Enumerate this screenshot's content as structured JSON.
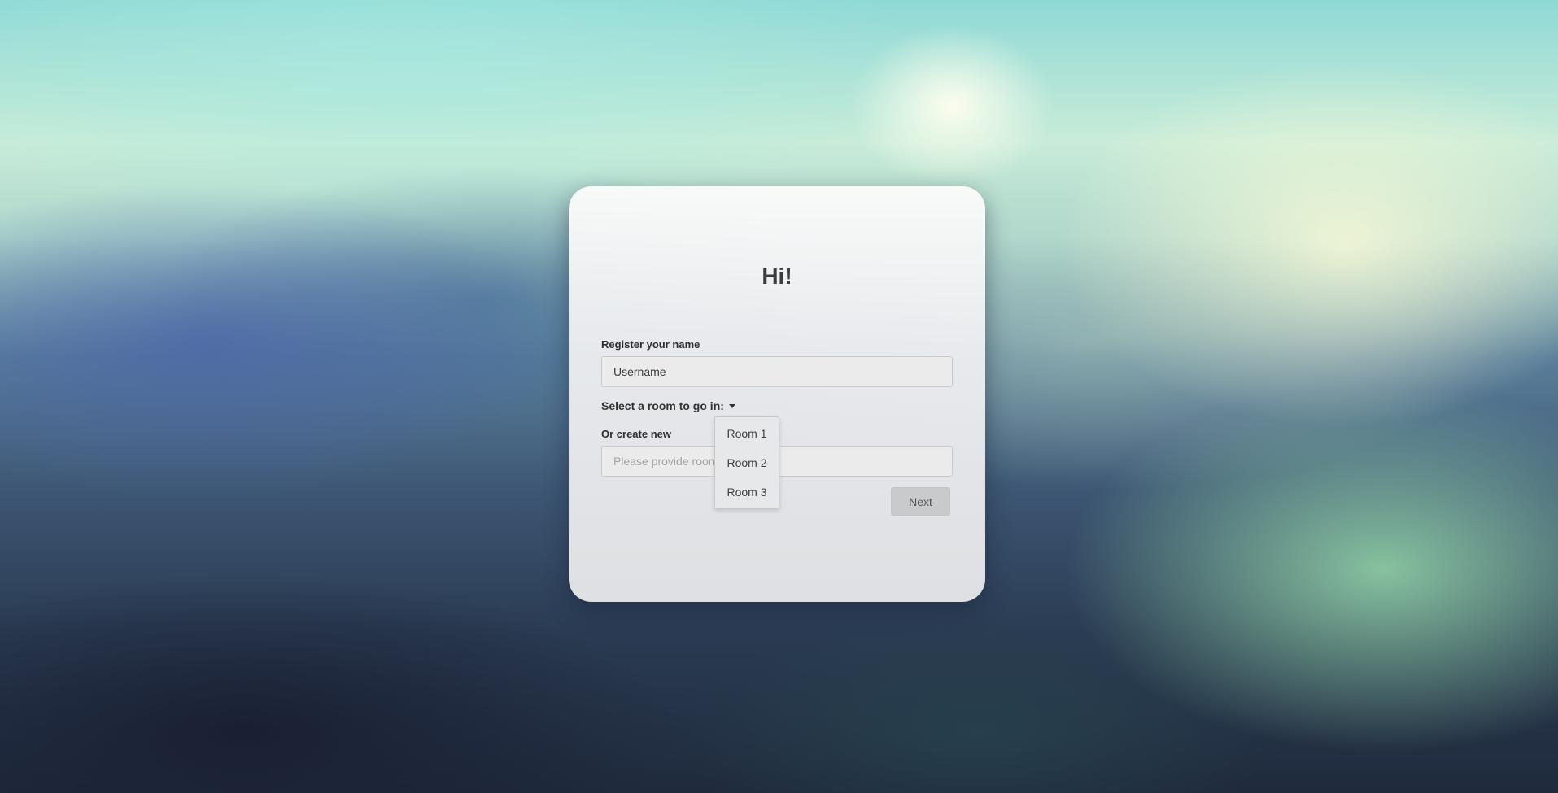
{
  "form": {
    "title": "Hi!",
    "name_label": "Register your name",
    "name_placeholder": "Username",
    "room_select_label": "Select a room to go in:",
    "create_label": "Or create new",
    "create_placeholder": "Please provide room name",
    "next_label": "Next"
  },
  "rooms": [
    "Room 1",
    "Room 2",
    "Room 3"
  ],
  "icons": {
    "room_select_caret": "caret-down-icon"
  },
  "colors": {
    "button_bg": "#c9cacc",
    "card_bg": "#ececee"
  }
}
